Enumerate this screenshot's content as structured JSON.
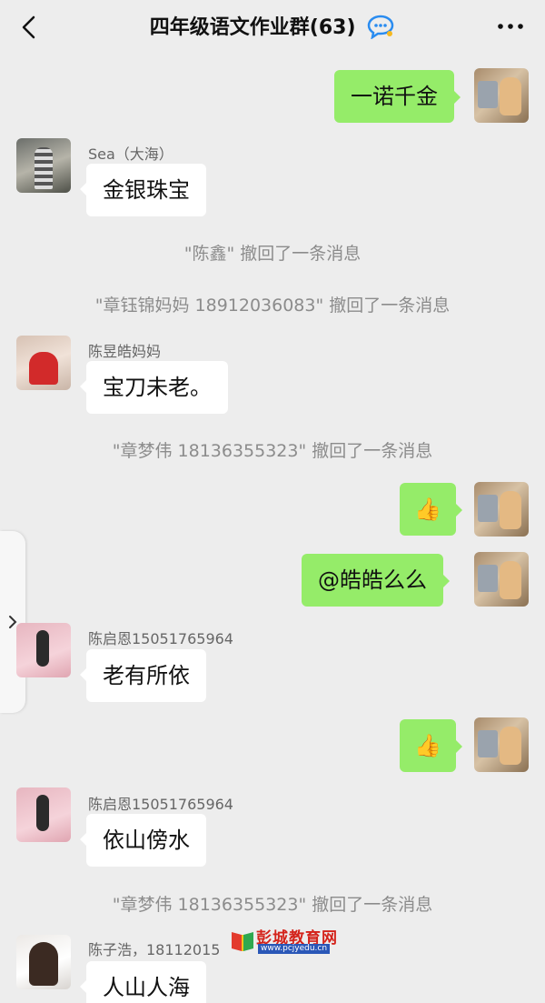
{
  "header": {
    "title": "四年级语文作业群(63)"
  },
  "messages": {
    "m1": {
      "text": "一诺千金"
    },
    "m2": {
      "sender": "Sea（大海）",
      "text": "金银珠宝"
    },
    "sys1": "\"陈鑫\" 撤回了一条消息",
    "sys2": "\"章钰锦妈妈 18912036083\" 撤回了一条消息",
    "m3": {
      "sender": "陈昱皓妈妈",
      "text": "宝刀未老。"
    },
    "sys3": "\"章梦伟 18136355323\" 撤回了一条消息",
    "m4": {
      "text": "👍"
    },
    "m5": {
      "text": "@皓皓么么"
    },
    "m6": {
      "sender": "陈启恩15051765964",
      "text": "老有所依"
    },
    "m7": {
      "text": "👍"
    },
    "m8": {
      "sender": "陈启恩15051765964",
      "text": "依山傍水"
    },
    "sys4": "\"章梦伟 18136355323\" 撤回了一条消息",
    "m9": {
      "sender": "陈子浩，18112015",
      "text": "人山人海"
    }
  },
  "watermark": {
    "title": "彭城教育网",
    "url": "www.pcjyedu.cn"
  },
  "icons": {
    "back": "chevron-left-icon",
    "more": "more-dots-icon",
    "group": "chat-bubble-icon",
    "side": "chevron-right-icon"
  },
  "colors": {
    "background": "#ededed",
    "outgoing_bubble": "#95ec69",
    "incoming_bubble": "#ffffff",
    "system_text": "#8c8c8c"
  }
}
